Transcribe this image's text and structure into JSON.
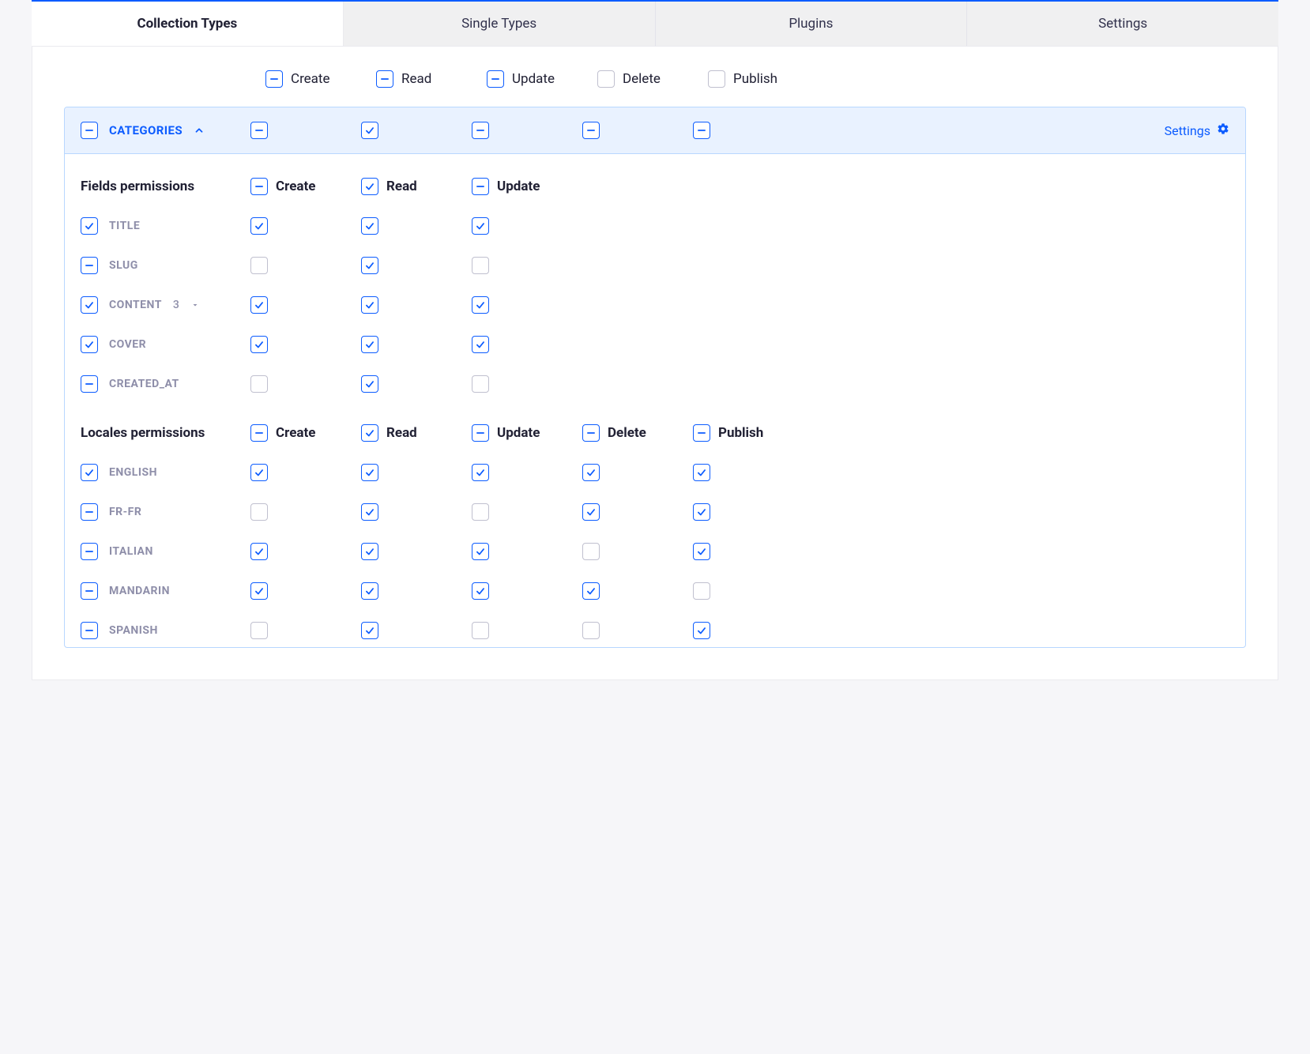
{
  "tabs": {
    "collection_types": "Collection Types",
    "single_types": "Single Types",
    "plugins": "Plugins",
    "settings": "Settings"
  },
  "columns": {
    "create": "Create",
    "read": "Read",
    "update": "Update",
    "delete": "Delete",
    "publish": "Publish"
  },
  "top_row_states": {
    "create": "partial",
    "read": "partial",
    "update": "partial",
    "delete": "unchecked",
    "publish": "unchecked"
  },
  "category": {
    "name": "CATEGORIES",
    "settings_label": "Settings",
    "header_states": {
      "create": "partial",
      "read": "checked",
      "update": "partial",
      "delete": "partial",
      "publish": "partial"
    }
  },
  "fields_section": {
    "title": "Fields permissions",
    "header_states": {
      "create": "partial",
      "read": "checked",
      "update": "partial"
    },
    "rows": [
      {
        "name": "TITLE",
        "row_state": "checked",
        "create": "checked",
        "read": "checked",
        "update": "checked"
      },
      {
        "name": "SLUG",
        "row_state": "partial",
        "create": "unchecked",
        "read": "checked",
        "update": "unchecked"
      },
      {
        "name": "CONTENT",
        "row_state": "checked",
        "badge": "3",
        "has_caret": true,
        "create": "checked",
        "read": "checked",
        "update": "checked"
      },
      {
        "name": "COVER",
        "row_state": "checked",
        "create": "checked",
        "read": "checked",
        "update": "checked"
      },
      {
        "name": "CREATED_AT",
        "row_state": "partial",
        "create": "unchecked",
        "read": "checked",
        "update": "unchecked"
      }
    ]
  },
  "locales_section": {
    "title": "Locales permissions",
    "header_states": {
      "create": "partial",
      "read": "checked",
      "update": "partial",
      "delete": "partial",
      "publish": "partial"
    },
    "rows": [
      {
        "name": "ENGLISH",
        "row_state": "checked",
        "create": "checked",
        "read": "checked",
        "update": "checked",
        "delete": "checked",
        "publish": "checked"
      },
      {
        "name": "FR-FR",
        "row_state": "partial",
        "create": "unchecked",
        "read": "checked",
        "update": "unchecked",
        "delete": "checked",
        "publish": "checked"
      },
      {
        "name": "ITALIAN",
        "row_state": "partial",
        "create": "checked",
        "read": "checked",
        "update": "checked",
        "delete": "unchecked",
        "publish": "checked"
      },
      {
        "name": "MANDARIN",
        "row_state": "partial",
        "create": "checked",
        "read": "checked",
        "update": "checked",
        "delete": "checked",
        "publish": "unchecked"
      },
      {
        "name": "SPANISH",
        "row_state": "partial",
        "create": "unchecked",
        "read": "checked",
        "update": "unchecked",
        "delete": "unchecked",
        "publish": "checked"
      }
    ]
  }
}
